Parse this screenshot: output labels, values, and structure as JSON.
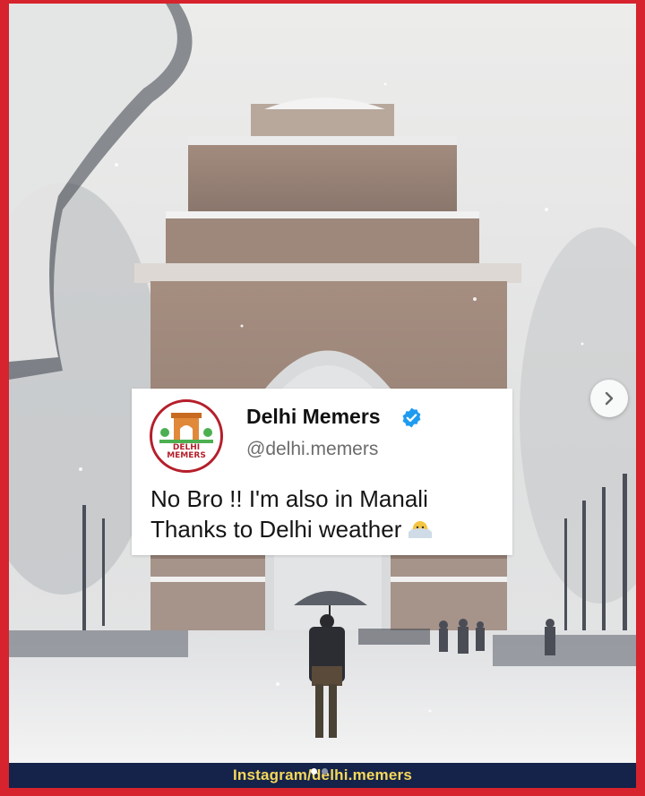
{
  "post": {
    "author_name": "Delhi Memers",
    "handle": "@delhi.memers",
    "verified": true,
    "text_line1": "No Bro !! I'm also in Manali",
    "text_line2": "Thanks to Delhi weather",
    "emoji": "cold-face-emoji",
    "avatar_text": "DELHI\nMEMERS"
  },
  "footer": {
    "caption": "Instagram/delhi.memers"
  },
  "carousel": {
    "dot_count": 2,
    "active_index": 0,
    "next_icon": "chevron-right-icon"
  },
  "colors": {
    "frame_border": "#d6232d",
    "footer_bg": "#15234a",
    "caption_text": "#f6d85a",
    "verified_badge": "#1d9bf0"
  }
}
